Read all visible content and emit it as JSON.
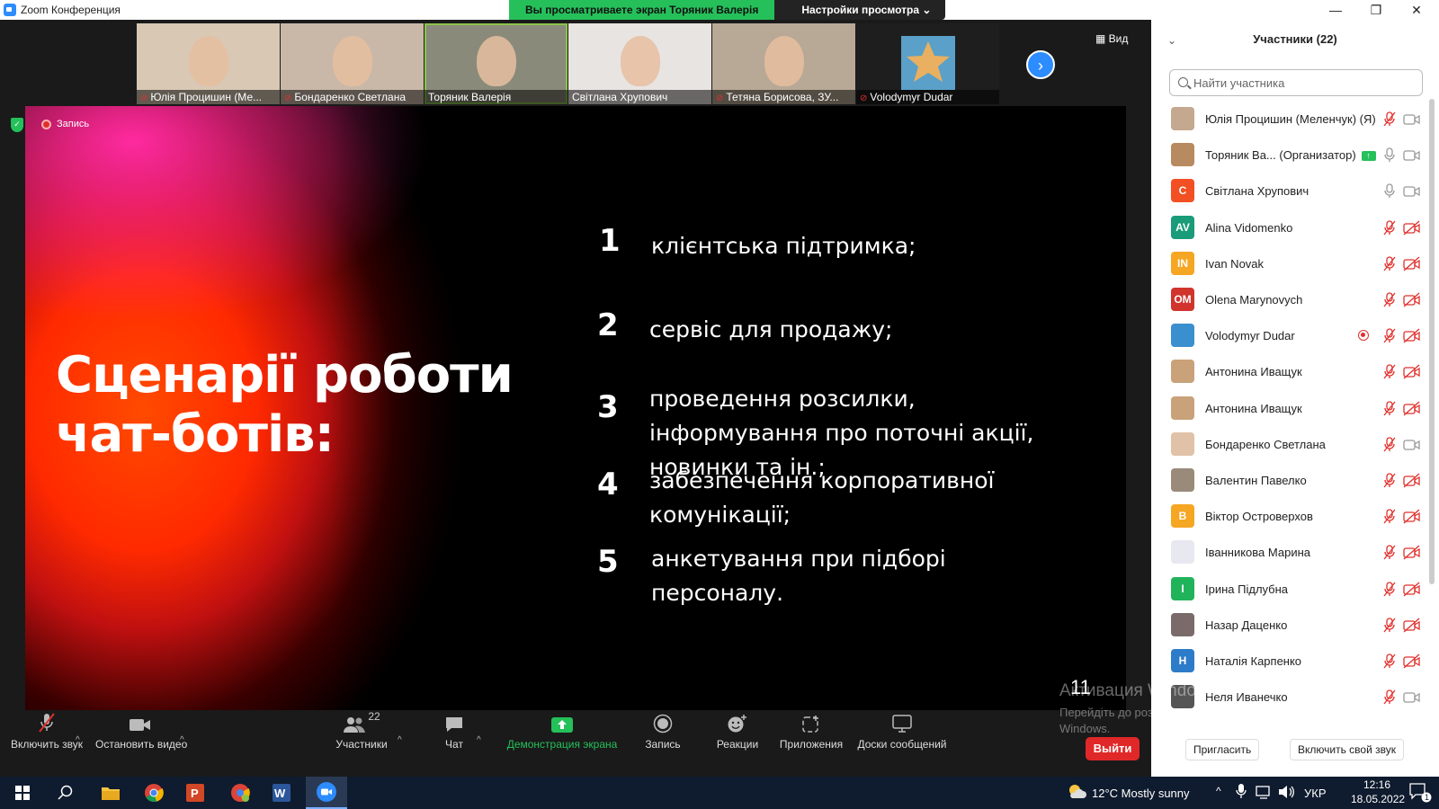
{
  "window": {
    "title": "Zoom Конференция",
    "minimize": "—",
    "maximize": "❐",
    "close": "✕"
  },
  "share_banner": {
    "viewing": "Вы просматриваете экран Торяник Валерія",
    "view_settings": "Настройки просмотра ⌄"
  },
  "view_label": "▦ Вид",
  "thumbnails": [
    {
      "name": "Юлія Процишин (Ме...",
      "muted": true,
      "bg": "#d8c8b4"
    },
    {
      "name": "Бондаренко Светлана",
      "muted": true,
      "bg": "#c9b8a8"
    },
    {
      "name": "Торяник Валерія",
      "muted": false,
      "bg": "#8a8a7a",
      "active": true
    },
    {
      "name": "Світлана Хрупович",
      "muted": false,
      "bg": "#e8e4e2"
    },
    {
      "name": "Тетяна Борисова, ЗУ...",
      "muted": true,
      "bg": "#b8a896"
    },
    {
      "name": "Volodymyr Dudar",
      "muted": true,
      "bg": "#1e1e1e"
    }
  ],
  "recording": {
    "label": "Запись"
  },
  "slide": {
    "heading_line1": "Сценарії роботи",
    "heading_line2": "чат-ботів:",
    "items": [
      {
        "num": "1",
        "text": "клієнтська підтримка;"
      },
      {
        "num": "2",
        "text": "сервіс для продажу;"
      },
      {
        "num": "3",
        "text": "проведення розсилки, інформування про поточні акції, новинки та ін.;"
      },
      {
        "num": "4",
        "text": "забезпечення корпоративної комунікації;"
      },
      {
        "num": "5",
        "text": "анкетування при підборі персоналу."
      }
    ],
    "page": "11"
  },
  "toolbar": {
    "unmute": "Включить звук",
    "start_video": "Остановить видео",
    "participants": "Участники",
    "participants_count": "22",
    "chat": "Чат",
    "share": "Демонстрация экрана",
    "record": "Запись",
    "reactions": "Реакции",
    "apps": "Приложения",
    "whiteboards": "Доски сообщений",
    "leave": "Выйти"
  },
  "watermark": {
    "line1": "Активация Windows",
    "line2": "Перейдіть до розділу \"Настройки\", щоб активувати",
    "line3": "Windows."
  },
  "panel": {
    "title": "Участники (22)",
    "search_placeholder": "Найти участника",
    "participants": [
      {
        "name": "Юлія Процишин (Меленчук) (Я)",
        "initials": "",
        "color": "#c4a890",
        "mic": "muted",
        "cam": "on"
      },
      {
        "name": "Торяник Ва... (Организатор)",
        "initials": "",
        "color": "#b88a60",
        "mic": "on",
        "cam": "on",
        "sharing": true
      },
      {
        "name": "Світлана Хрупович",
        "initials": "С",
        "color": "#f25022",
        "mic": "on",
        "cam": "on"
      },
      {
        "name": "Alina Vidomenko",
        "initials": "AV",
        "color": "#1a9b7a",
        "mic": "muted",
        "cam": "off"
      },
      {
        "name": "Ivan Novak",
        "initials": "IN",
        "color": "#f5a623",
        "mic": "muted",
        "cam": "off"
      },
      {
        "name": "Olena Marynovych",
        "initials": "OM",
        "color": "#d0342c",
        "mic": "muted",
        "cam": "off"
      },
      {
        "name": "Volodymyr Dudar",
        "initials": "",
        "color": "#3a8fcf",
        "mic": "muted",
        "cam": "off",
        "recording": true
      },
      {
        "name": "Антонина Иващук",
        "initials": "",
        "color": "#c9a27a",
        "mic": "muted",
        "cam": "off"
      },
      {
        "name": "Антонина Иващук",
        "initials": "",
        "color": "#c9a27a",
        "mic": "muted",
        "cam": "off"
      },
      {
        "name": "Бондаренко Светлана",
        "initials": "",
        "color": "#e0c2a8",
        "mic": "muted",
        "cam": "on"
      },
      {
        "name": "Валентин Павелко",
        "initials": "",
        "color": "#9a8a7a",
        "mic": "muted",
        "cam": "off"
      },
      {
        "name": "Віктор Островерхов",
        "initials": "В",
        "color": "#f5a623",
        "mic": "muted",
        "cam": "off"
      },
      {
        "name": "Іванникова Марина",
        "initials": "",
        "color": "#e8e8f0",
        "mic": "muted",
        "cam": "off"
      },
      {
        "name": "Ірина Підлубна",
        "initials": "І",
        "color": "#21b35a",
        "mic": "muted",
        "cam": "off"
      },
      {
        "name": "Назар Даценко",
        "initials": "",
        "color": "#7a6a6a",
        "mic": "muted",
        "cam": "off"
      },
      {
        "name": "Наталія Карпенко",
        "initials": "Н",
        "color": "#2d7cc9",
        "mic": "muted",
        "cam": "off"
      },
      {
        "name": "Неля Иванечко",
        "initials": "",
        "color": "#555",
        "mic": "muted",
        "cam": "on"
      }
    ],
    "invite": "Пригласить",
    "unmute_me": "Включить свой звук"
  },
  "taskbar": {
    "weather": "12°C  Mostly sunny",
    "lang": "УКР",
    "time": "12:16",
    "date": "18.05.2022",
    "notif": "1"
  }
}
